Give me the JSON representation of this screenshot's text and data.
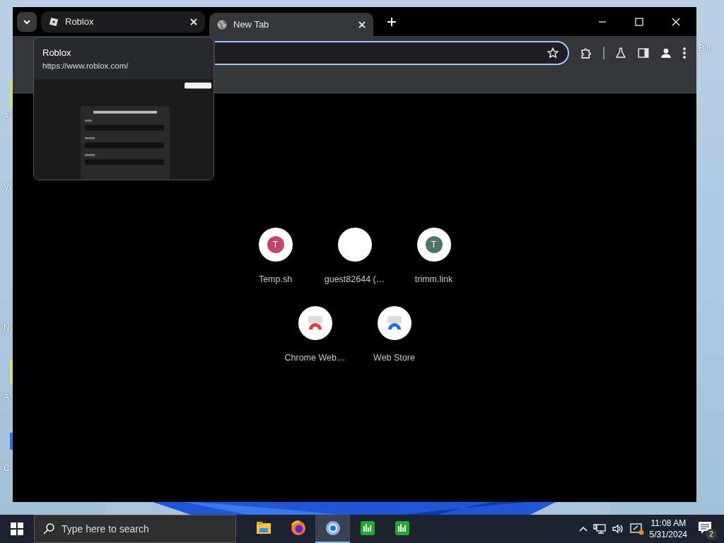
{
  "desktop": {
    "icon_labels": [
      {
        "text": "Al"
      },
      {
        "text": "Vi"
      },
      {
        "text": "N"
      },
      {
        "text": "A"
      },
      {
        "text": "C"
      },
      {
        "text": "Bin"
      }
    ]
  },
  "browser": {
    "tabs": [
      {
        "title": "Roblox",
        "selected": false,
        "hovered": true
      },
      {
        "title": "New Tab",
        "selected": true,
        "hovered": false
      }
    ],
    "hover_card": {
      "title": "Roblox",
      "url": "https://www.roblox.com/"
    },
    "shortcuts": [
      {
        "label": "Temp.sh",
        "kind": "letter",
        "letter": "T",
        "color": "#c0466a"
      },
      {
        "label": "guest82644 (…",
        "kind": "blank"
      },
      {
        "label": "trimm.link",
        "kind": "letter",
        "letter": "T",
        "color": "#4f7463"
      },
      {
        "label": "Chrome Web…",
        "kind": "store",
        "color": "#e53935"
      },
      {
        "label": "Web Store",
        "kind": "store",
        "color": "#1e6fe0"
      }
    ]
  },
  "taskbar": {
    "search": {
      "placeholder": "Type here to search"
    },
    "apps": [
      {
        "kind": "folder",
        "selected": false
      },
      {
        "kind": "firefox",
        "selected": false
      },
      {
        "kind": "chrome",
        "selected": true
      },
      {
        "kind": "chart",
        "selected": false
      },
      {
        "kind": "chart",
        "selected": false
      }
    ],
    "time": "11:08 AM",
    "date": "5/31/2024",
    "notification_count": "2"
  }
}
